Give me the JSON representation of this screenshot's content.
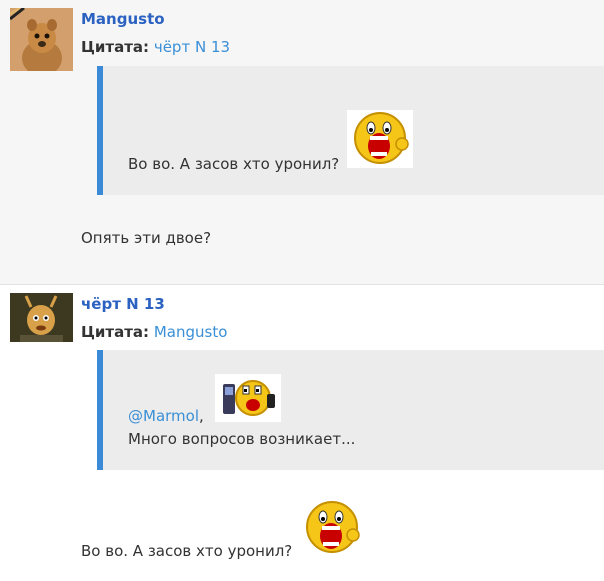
{
  "posts": [
    {
      "author": "Mangusto",
      "quote_label": "Цитата:",
      "quote_source": "чёрт N 13",
      "quote_text": "Во во. А засов хто уронил?",
      "body": "Опять эти двое?"
    },
    {
      "author": "чёрт N 13",
      "quote_label": "Цитата:",
      "quote_source": "Mangusto",
      "quote_mention": "@Marmol",
      "quote_comma": ",",
      "quote_text": "Много вопросов возникает...",
      "body": "Во во. А засов хто уронил?"
    }
  ],
  "colors": {
    "author": "#2b62c2",
    "link": "#3a8fd6",
    "quote_border": "#3b8ad8",
    "quote_bg": "#ececec",
    "post1_bg": "#f6f6f6"
  },
  "icons": [
    "mongoose-avatar",
    "devil-avatar",
    "laughing-smiley-icon",
    "phone-smiley-icon"
  ]
}
